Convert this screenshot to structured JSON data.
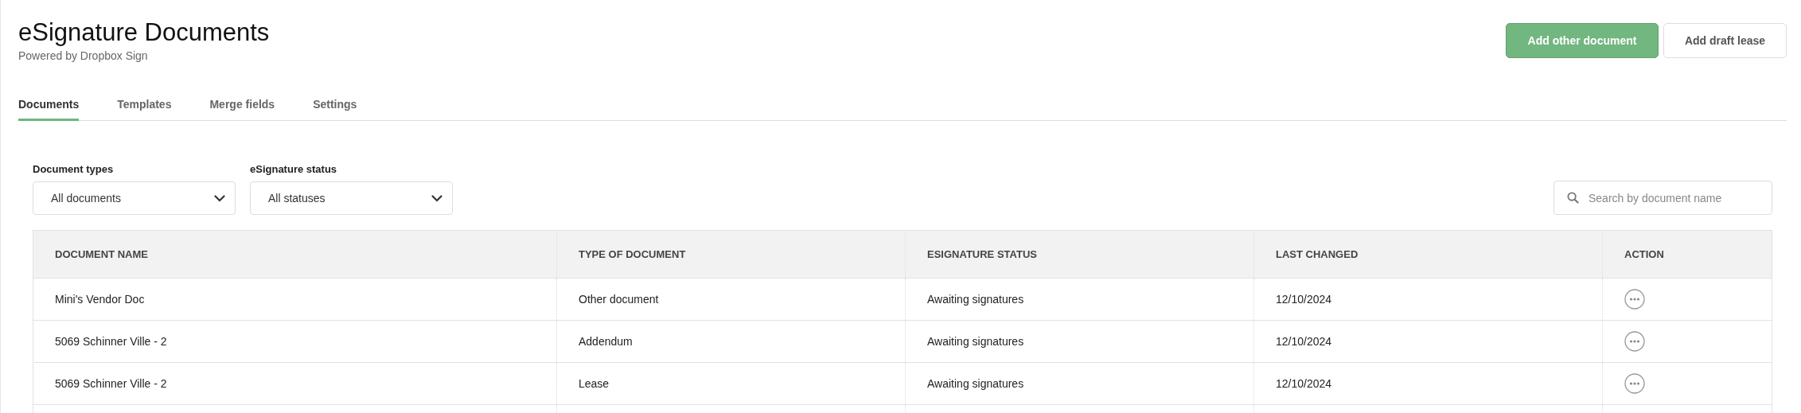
{
  "header": {
    "title": "eSignature Documents",
    "subtitle": "Powered by Dropbox Sign"
  },
  "actions": [
    {
      "label": "Add other document",
      "kind": "primary"
    },
    {
      "label": "Add draft lease",
      "kind": "secondary"
    }
  ],
  "tabs": [
    {
      "label": "Documents",
      "selected": true
    },
    {
      "label": "Templates",
      "selected": false
    },
    {
      "label": "Merge fields",
      "selected": false
    },
    {
      "label": "Settings",
      "selected": false
    }
  ],
  "filters": [
    {
      "label": "Document types",
      "value": "All documents"
    },
    {
      "label": "eSignature status",
      "value": "All statuses"
    }
  ],
  "search": {
    "placeholder": "Search by document name"
  },
  "table": {
    "columns": [
      "DOCUMENT NAME",
      "TYPE OF DOCUMENT",
      "ESIGNATURE STATUS",
      "LAST CHANGED",
      "ACTION"
    ],
    "rows": [
      {
        "name": "Mini's Vendor Doc",
        "type": "Other document",
        "status": "Awaiting signatures",
        "changed": "12/10/2024"
      },
      {
        "name": "5069 Schinner Ville - 2",
        "type": "Addendum",
        "status": "Awaiting signatures",
        "changed": "12/10/2024"
      },
      {
        "name": "5069 Schinner Ville - 2",
        "type": "Lease",
        "status": "Awaiting signatures",
        "changed": "12/10/2024"
      }
    ]
  }
}
